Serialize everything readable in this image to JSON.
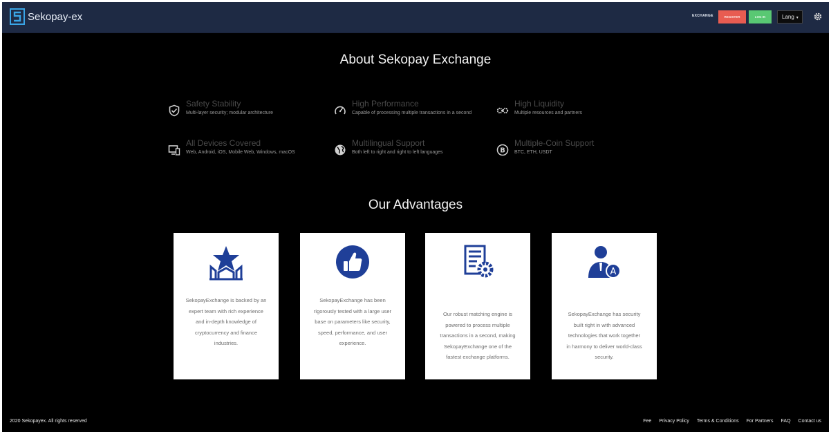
{
  "nav": {
    "brand": "Sekopay-ex",
    "exchange": "EXCHANGE",
    "register": "REGISTER",
    "login": "LOG IN",
    "lang": "Lang",
    "settings_icon": "gear-icon"
  },
  "about": {
    "heading": "About Sekopay Exchange",
    "features": [
      {
        "title": "Safety Stability",
        "desc": "Multi-layer security; modular architecture",
        "icon": "shield-check-icon"
      },
      {
        "title": "High Performance",
        "desc": "Capable of processing multiple transactions in a second",
        "icon": "speedometer-icon"
      },
      {
        "title": "High Liquidity",
        "desc": "Multiple resources and partners",
        "icon": "gears-icon"
      },
      {
        "title": "All Devices Covered",
        "desc": "Web, Android, iOS, Mobile Web, Windows, macOS",
        "icon": "devices-icon"
      },
      {
        "title": "Multilingual Support",
        "desc": "Both left to right and right to left languages",
        "icon": "globe-icon"
      },
      {
        "title": "Multiple-Coin Support",
        "desc": "BTC, ETH, USDT",
        "icon": "bitcoin-icon"
      }
    ]
  },
  "advantages": {
    "heading": "Our Advantages",
    "cards": [
      {
        "icon": "star-building-icon",
        "lines": [
          "SekopayExchange is backed by an",
          "expert team with rich experience",
          "and in-depth knowledge of",
          "cryptocurrency and finance",
          "industries."
        ]
      },
      {
        "icon": "thumbs-up-icon",
        "lines": [
          "SekopayExchange has been",
          "rigorously tested with a large user",
          "base on parameters like security,",
          "speed, performance, and user",
          "experience."
        ]
      },
      {
        "icon": "document-gear-icon",
        "lines": [
          "Our robust matching engine is",
          "powered to process multiple",
          "transactions in a second, making",
          "SekopayExchange one of the",
          "fastest exchange platforms."
        ]
      },
      {
        "icon": "user-security-icon",
        "lines": [
          "SekopayExchange has security",
          "built right in with advanced",
          "technologies that work together",
          "in harmony to deliver world-class",
          "security."
        ]
      }
    ]
  },
  "footer": {
    "copyright": "2020 Sekopayex. All rights reserved",
    "links": [
      "Fee",
      "Privacy Policy",
      "Terms & Conditions",
      "For Partners",
      "FAQ",
      "Contact us"
    ]
  },
  "colors": {
    "navbar": "#1e2a44",
    "register": "#e85c51",
    "login": "#59c873",
    "icon_blue": "#1f3f98"
  }
}
